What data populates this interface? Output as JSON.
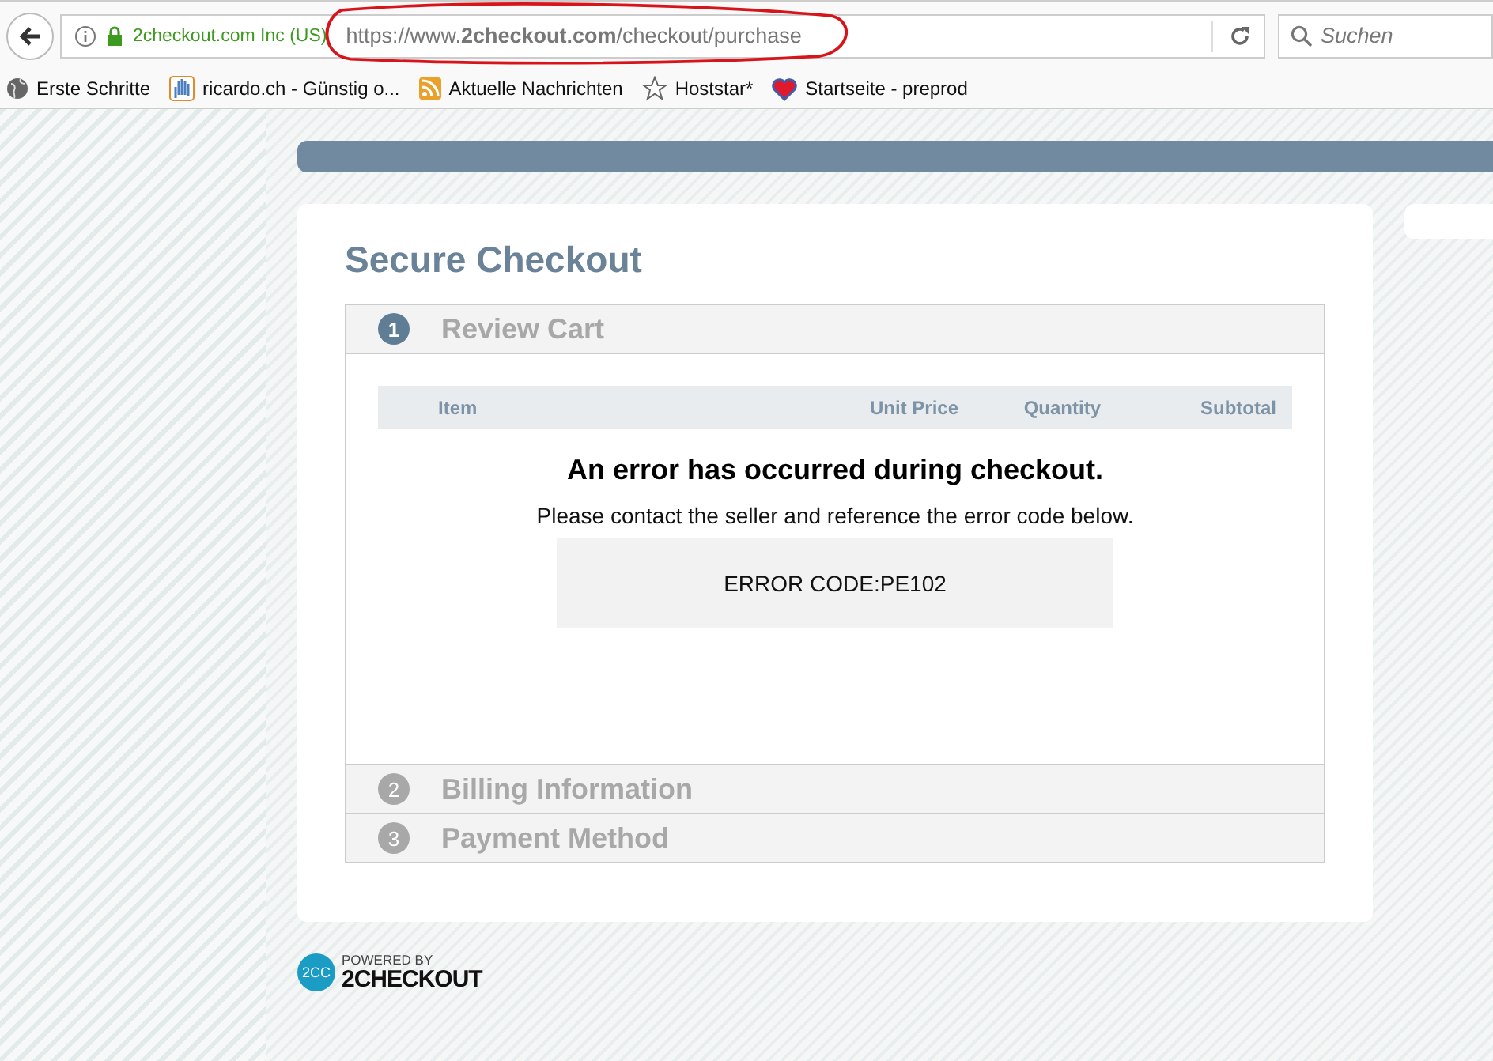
{
  "browser": {
    "site_identity": "2checkout.com Inc (US)",
    "url": "https://www.**2checkout.com**/checkout/purchase",
    "search": {
      "placeholder": "Suchen"
    },
    "bookmarks": [
      {
        "label": "Erste Schritte",
        "kind": "globe"
      },
      {
        "label": "ricardo.ch - Günstig o...",
        "kind": "hand"
      },
      {
        "label": "Aktuelle Nachrichten",
        "kind": "feed"
      },
      {
        "label": "Hoststar*",
        "kind": "star"
      },
      {
        "label": "Startseite - preprod",
        "kind": "heart"
      }
    ]
  },
  "checkout": {
    "title": "Secure Checkout",
    "steps": [
      {
        "number": "1",
        "title": "Review Cart",
        "expanded": true
      },
      {
        "number": "2",
        "title": "Billing Information",
        "expanded": false
      },
      {
        "number": "3",
        "title": "Payment Method",
        "expanded": false
      }
    ],
    "cart_columns": [
      "Item",
      "Unit Price",
      "Quantity",
      "Subtotal"
    ],
    "error": {
      "heading": "An error has occurred during checkout.",
      "message": "Please contact the seller and reference the error code below.",
      "code": "ERROR CODE:PE102"
    }
  },
  "footer": {
    "logo_mark": "2CC",
    "powered_by": "POWERED BY",
    "brand": "2CHECKOUT"
  }
}
